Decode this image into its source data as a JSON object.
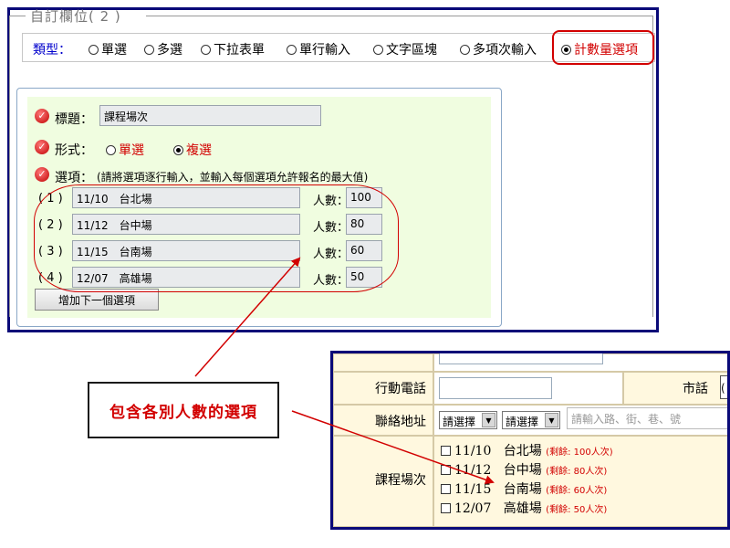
{
  "panel1": {
    "legend": "自訂欄位( 2 )",
    "type_label": "類型：",
    "type_options": [
      {
        "label": "單選",
        "selected": false
      },
      {
        "label": "多選",
        "selected": false
      },
      {
        "label": "下拉表單",
        "selected": false
      },
      {
        "label": "單行輸入",
        "selected": false
      },
      {
        "label": "文字區塊",
        "selected": false
      },
      {
        "label": "多項次輸入",
        "selected": false
      },
      {
        "label": "計數量選項",
        "selected": true
      }
    ],
    "title_label": "標題：",
    "title_value": "課程場次",
    "form_label": "形式：",
    "form_options": [
      {
        "label": "單選",
        "selected": false
      },
      {
        "label": "複選",
        "selected": true
      }
    ],
    "options_label": "選項：",
    "options_hint": "(請將選項逐行輸入，並輸入每個選項允許報名的最大值)",
    "count_label": "人數：",
    "options": [
      {
        "index": "( 1 )",
        "text": "11/10　台北場",
        "count": "100"
      },
      {
        "index": "( 2 )",
        "text": "11/12　台中場",
        "count": "80"
      },
      {
        "index": "( 3 )",
        "text": "11/15　台南場",
        "count": "60"
      },
      {
        "index": "( 4 )",
        "text": "12/07　高雄場",
        "count": "50"
      }
    ],
    "add_button": "增加下一個選項"
  },
  "annotation": {
    "callout": "包含各別人數的選項"
  },
  "panel2": {
    "mobile_label": "行動電話",
    "phone_label": "市話",
    "address_label": "聯絡地址",
    "select1": "請選擇",
    "select2": "請選擇",
    "address_placeholder": "請輸入路、街、巷、號",
    "session_label": "課程場次",
    "sessions": [
      {
        "date": "11/10",
        "name": "台北場",
        "remain": "(剩餘: 100人次)"
      },
      {
        "date": "11/12",
        "name": "台中場",
        "remain": "(剩餘: 80人次)"
      },
      {
        "date": "11/15",
        "name": "台南場",
        "remain": "(剩餘: 60人次)"
      },
      {
        "date": "12/07",
        "name": "高雄場",
        "remain": "(剩餘: 50人次)"
      }
    ]
  },
  "colors": {
    "frame": "#0a0a78",
    "highlight_red": "#d20000",
    "type_label_blue": "#0000cc",
    "panel_green": "#f0fde0",
    "table_cream": "#fff8df"
  }
}
